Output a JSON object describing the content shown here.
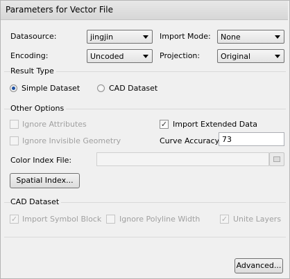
{
  "window": {
    "title": "Parameters for Vector File"
  },
  "datasource": {
    "label": "Datasource:",
    "value": "jingjin"
  },
  "import_mode": {
    "label": "Import Mode:",
    "value": "None"
  },
  "encoding": {
    "label": "Encoding:",
    "value": "Uncoded"
  },
  "projection": {
    "label": "Projection:",
    "value": "Original"
  },
  "result_type": {
    "group_label": "Result Type",
    "simple_dataset": {
      "label": "Simple Dataset",
      "selected": true
    },
    "cad_dataset": {
      "label": "CAD Dataset",
      "selected": false
    }
  },
  "other_options": {
    "group_label": "Other Options",
    "ignore_attributes": {
      "label": "Ignore Attributes",
      "checked": false,
      "enabled": false
    },
    "import_extended_data": {
      "label": "Import Extended Data",
      "checked": true,
      "enabled": true
    },
    "ignore_invisible_geometry": {
      "label": "Ignore Invisible Geometry",
      "checked": false,
      "enabled": false
    },
    "curve_accuracy": {
      "label": "Curve Accuracy:",
      "value": "73"
    },
    "color_index_file": {
      "label": "Color Index File:",
      "value": ""
    },
    "spatial_index_button": "Spatial Index..."
  },
  "cad_dataset": {
    "group_label": "CAD Dataset",
    "import_symbol_block": {
      "label": "Import Symbol Block",
      "checked": true,
      "enabled": false
    },
    "ignore_polyline_width": {
      "label": "Ignore Polyline Width",
      "checked": false,
      "enabled": false
    },
    "unite_layers": {
      "label": "Unite Layers",
      "checked": true,
      "enabled": false
    }
  },
  "advanced_button": "Advanced...",
  "icons": {
    "dropdown": "chevron-down-icon",
    "check": "checkmark-icon",
    "browse": "folder-icon"
  }
}
